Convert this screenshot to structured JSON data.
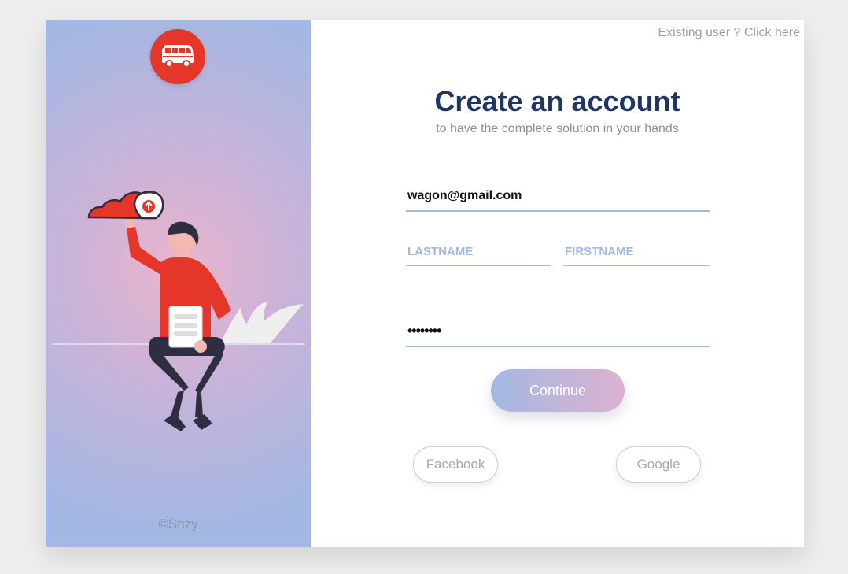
{
  "brand": {
    "accent": "#e5362a",
    "primary_dark": "#1f3563",
    "line": "#a3b8e3"
  },
  "left_panel": {
    "copyright": "©Snzy",
    "logo_icon": "bus-icon"
  },
  "header": {
    "existing_user": "Existing user ? Click here"
  },
  "main": {
    "title": "Create an account",
    "subtitle": "to have the complete solution in your hands"
  },
  "form": {
    "email_value": "wagon@gmail.com",
    "lastname_placeholder": "LASTNAME",
    "firstname_placeholder": "FIRSTNAME",
    "password_value": "password",
    "continue_label": "Continue"
  },
  "social": {
    "facebook_label": "Facebook",
    "google_label": "Google"
  }
}
